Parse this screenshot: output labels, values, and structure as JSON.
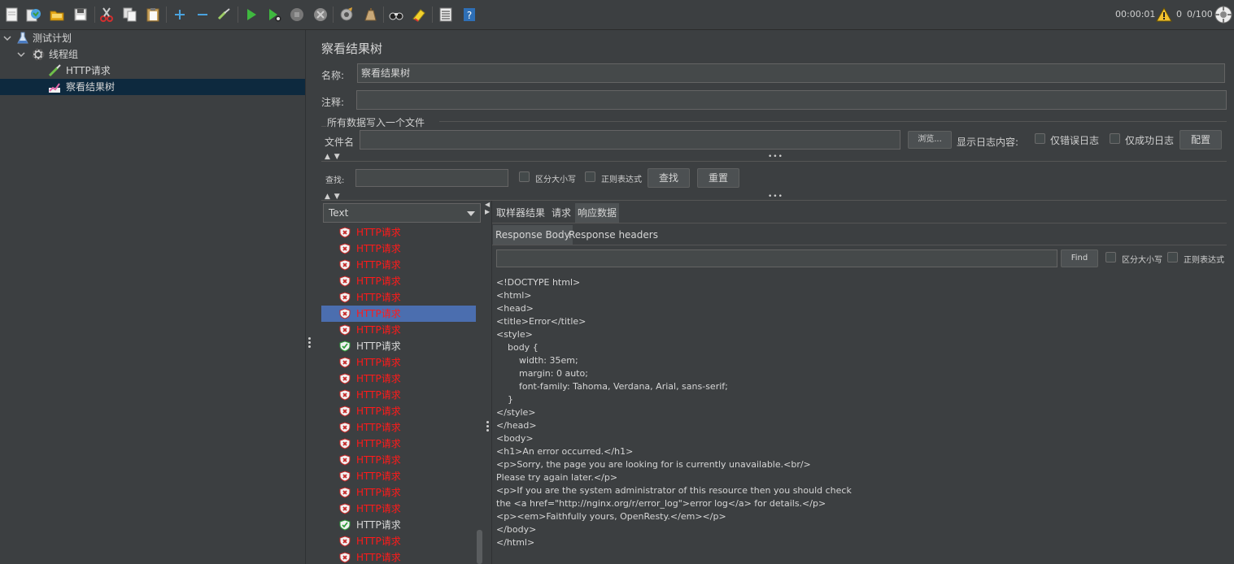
{
  "toolbar": {
    "timer": "00:00:01",
    "warning_count": "0",
    "threads": "0/100"
  },
  "tree": {
    "items": [
      {
        "label": "测试计划"
      },
      {
        "label": "线程组"
      },
      {
        "label": "HTTP请求"
      },
      {
        "label": "察看结果树"
      }
    ]
  },
  "panel": {
    "title": "察看结果树",
    "name_label": "名称:",
    "name_value": "察看结果树",
    "comment_label": "注释:",
    "comment_value": "",
    "group_label": "所有数据写入一个文件",
    "filename_label": "文件名",
    "filename_value": "",
    "browse_label": "浏览...",
    "log_label": "显示日志内容:",
    "errors_only_label": "仅错误日志",
    "success_only_label": "仅成功日志",
    "configure_label": "配置",
    "search_label": "查找:",
    "search_value": "",
    "case_sensitive_label": "区分大小写",
    "regex_label": "正则表达式",
    "find_button": "查找",
    "reset_button": "重置"
  },
  "results": {
    "renderer": "Text",
    "items": [
      {
        "label": "HTTP请求",
        "status": "error"
      },
      {
        "label": "HTTP请求",
        "status": "error"
      },
      {
        "label": "HTTP请求",
        "status": "error"
      },
      {
        "label": "HTTP请求",
        "status": "error"
      },
      {
        "label": "HTTP请求",
        "status": "error"
      },
      {
        "label": "HTTP请求",
        "status": "error",
        "selected": true
      },
      {
        "label": "HTTP请求",
        "status": "error"
      },
      {
        "label": "HTTP请求",
        "status": "success"
      },
      {
        "label": "HTTP请求",
        "status": "error"
      },
      {
        "label": "HTTP请求",
        "status": "error"
      },
      {
        "label": "HTTP请求",
        "status": "error"
      },
      {
        "label": "HTTP请求",
        "status": "error"
      },
      {
        "label": "HTTP请求",
        "status": "error"
      },
      {
        "label": "HTTP请求",
        "status": "error"
      },
      {
        "label": "HTTP请求",
        "status": "error"
      },
      {
        "label": "HTTP请求",
        "status": "error"
      },
      {
        "label": "HTTP请求",
        "status": "error"
      },
      {
        "label": "HTTP请求",
        "status": "error"
      },
      {
        "label": "HTTP请求",
        "status": "success"
      },
      {
        "label": "HTTP请求",
        "status": "error"
      },
      {
        "label": "HTTP请求",
        "status": "error"
      }
    ]
  },
  "detail": {
    "tabs": [
      {
        "label": "取样器结果"
      },
      {
        "label": "请求"
      },
      {
        "label": "响应数据",
        "active": true
      }
    ],
    "subtabs": [
      {
        "label": "Response Body",
        "active": true
      },
      {
        "label": "Response headers"
      }
    ],
    "find_label": "Find",
    "case_sensitive_label": "区分大小写",
    "regex_label": "正则表达式",
    "response_lines": [
      "<!DOCTYPE html>",
      "<html>",
      "<head>",
      "<title>Error</title>",
      "<style>",
      "    body {",
      "        width: 35em;",
      "        margin: 0 auto;",
      "        font-family: Tahoma, Verdana, Arial, sans-serif;",
      "    }",
      "</style>",
      "</head>",
      "<body>",
      "<h1>An error occurred.</h1>",
      "<p>Sorry, the page you are looking for is currently unavailable.<br/>",
      "Please try again later.</p>",
      "<p>If you are the system administrator of this resource then you should check",
      "the <a href=\"http://nginx.org/r/error_log\">error log</a> for details.</p>",
      "<p><em>Faithfully yours, OpenResty.</em></p>",
      "</body>",
      "</html>"
    ]
  }
}
